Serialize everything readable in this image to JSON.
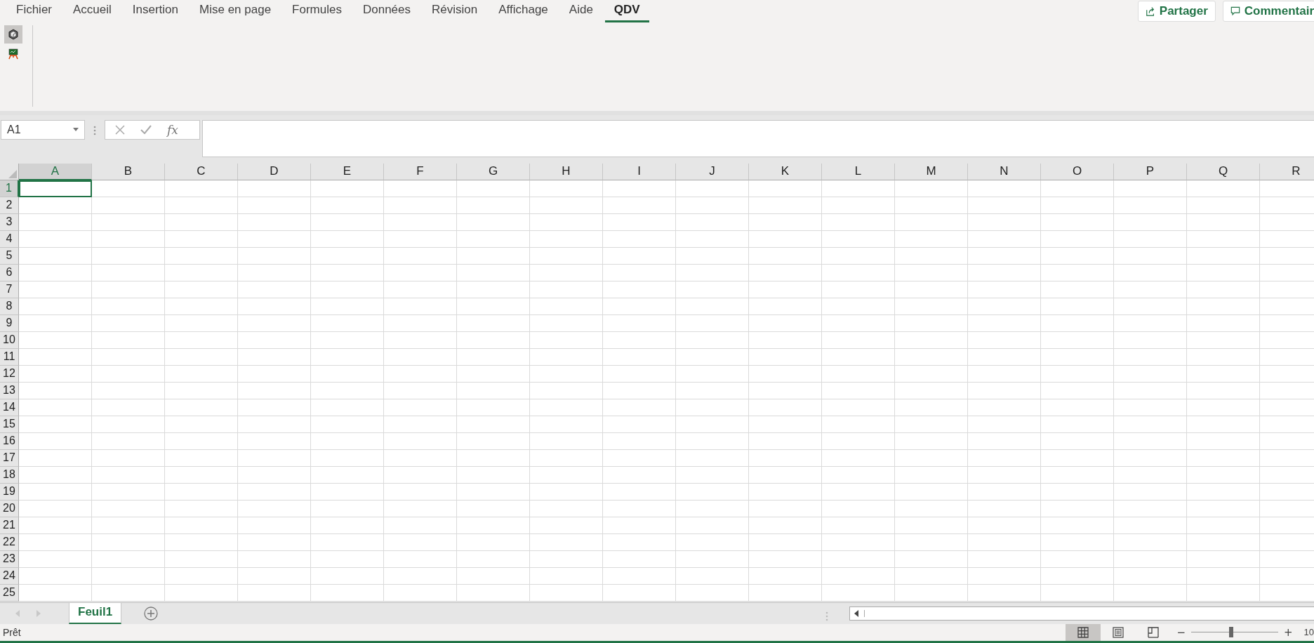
{
  "menu_tabs": [
    {
      "label": "Fichier",
      "selected": false
    },
    {
      "label": "Accueil",
      "selected": false
    },
    {
      "label": "Insertion",
      "selected": false
    },
    {
      "label": "Mise en page",
      "selected": false
    },
    {
      "label": "Formules",
      "selected": false
    },
    {
      "label": "Données",
      "selected": false
    },
    {
      "label": "Révision",
      "selected": false
    },
    {
      "label": "Affichage",
      "selected": false
    },
    {
      "label": "Aide",
      "selected": false
    },
    {
      "label": "QDV",
      "selected": true
    }
  ],
  "header_buttons": [
    {
      "kind": "share",
      "label": "Partager"
    },
    {
      "kind": "comment",
      "label": "Commentair"
    }
  ],
  "ribbon": {
    "buttons": [
      {
        "kind": "cube",
        "selected": true
      },
      {
        "kind": "board",
        "selected": false
      }
    ]
  },
  "formula_bar": {
    "name_box": "A1",
    "function_label": "fx"
  },
  "sheet": {
    "columns": [
      {
        "label": "A",
        "selected": true
      },
      {
        "label": "B",
        "selected": false
      },
      {
        "label": "C",
        "selected": false
      },
      {
        "label": "D",
        "selected": false
      },
      {
        "label": "E",
        "selected": false
      },
      {
        "label": "F",
        "selected": false
      },
      {
        "label": "G",
        "selected": false
      },
      {
        "label": "H",
        "selected": false
      },
      {
        "label": "I",
        "selected": false
      },
      {
        "label": "J",
        "selected": false
      },
      {
        "label": "K",
        "selected": false
      },
      {
        "label": "L",
        "selected": false
      },
      {
        "label": "M",
        "selected": false
      },
      {
        "label": "N",
        "selected": false
      },
      {
        "label": "O",
        "selected": false
      },
      {
        "label": "P",
        "selected": false
      },
      {
        "label": "Q",
        "selected": false
      },
      {
        "label": "R",
        "selected": false
      }
    ],
    "rows": [
      {
        "label": "1",
        "selected": true
      },
      {
        "label": "2",
        "selected": false
      },
      {
        "label": "3",
        "selected": false
      },
      {
        "label": "4",
        "selected": false
      },
      {
        "label": "5",
        "selected": false
      },
      {
        "label": "6",
        "selected": false
      },
      {
        "label": "7",
        "selected": false
      },
      {
        "label": "8",
        "selected": false
      },
      {
        "label": "9",
        "selected": false
      },
      {
        "label": "10",
        "selected": false
      },
      {
        "label": "11",
        "selected": false
      },
      {
        "label": "12",
        "selected": false
      },
      {
        "label": "13",
        "selected": false
      },
      {
        "label": "14",
        "selected": false
      },
      {
        "label": "15",
        "selected": false
      },
      {
        "label": "16",
        "selected": false
      },
      {
        "label": "17",
        "selected": false
      },
      {
        "label": "18",
        "selected": false
      },
      {
        "label": "19",
        "selected": false
      },
      {
        "label": "20",
        "selected": false
      },
      {
        "label": "21",
        "selected": false
      },
      {
        "label": "22",
        "selected": false
      },
      {
        "label": "23",
        "selected": false
      },
      {
        "label": "24",
        "selected": false
      },
      {
        "label": "25",
        "selected": false
      }
    ]
  },
  "sheet_tabs": [
    {
      "label": "Feuil1",
      "selected": true
    }
  ],
  "status_bar": {
    "status": "Prêt",
    "views": [
      {
        "kind": "normal",
        "selected": true
      },
      {
        "kind": "page_layout",
        "selected": false
      },
      {
        "kind": "page_break",
        "selected": false
      }
    ],
    "zoom": {
      "minus": "−",
      "plus": "+",
      "level": 0.46,
      "reading": "10"
    }
  }
}
